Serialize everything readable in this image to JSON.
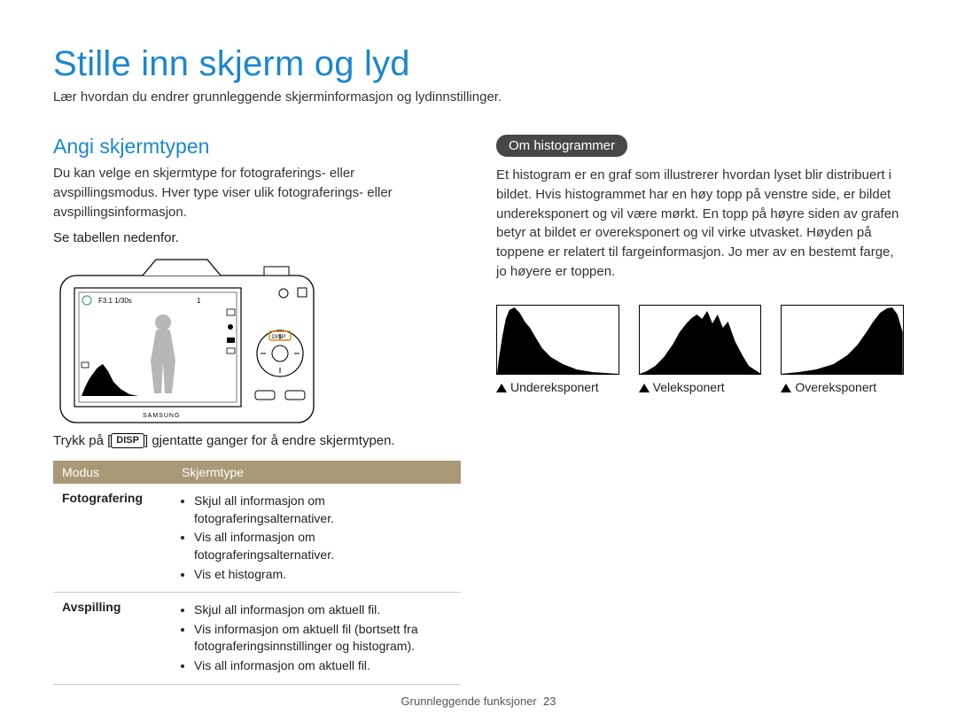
{
  "header": {
    "title": "Stille inn skjerm og lyd",
    "intro": "Lær hvordan du endrer grunnleggende skjerminformasjon og lydinnstillinger."
  },
  "left": {
    "heading": "Angi skjermtypen",
    "body": "Du kan velge en skjermtype for fotograferings- eller avspillingsmodus. Hver type viser ulik fotograferings- eller avspillingsinformasjon.",
    "see": "Se tabellen nedenfor.",
    "press_pre": "Trykk på [",
    "press_btn": "DISP",
    "press_post": "] gjentatte ganger for å endre skjermtypen.",
    "screen_readout": "F3.1 1/30s",
    "screen_count": "1",
    "disp_label": "DISP",
    "brand": "SAMSUNG",
    "table": {
      "col1": "Modus",
      "col2": "Skjermtype",
      "rows": [
        {
          "mode": "Fotografering",
          "items": [
            "Skjul all informasjon om fotograferingsalternativer.",
            "Vis all informasjon om fotograferingsalternativer.",
            "Vis et histogram."
          ]
        },
        {
          "mode": "Avspilling",
          "items": [
            "Skjul all informasjon om aktuell fil.",
            "Vis informasjon om aktuell fil (bortsett fra fotograferingsinnstillinger og histogram).",
            "Vis all informasjon om aktuell fil."
          ]
        }
      ]
    }
  },
  "right": {
    "badge": "Om histogrammer",
    "body": "Et histogram er en graf som illustrerer hvordan lyset blir distribuert i bildet. Hvis histogrammet har en høy topp på venstre side, er bildet undereksponert og vil være mørkt. En topp på høyre siden av grafen betyr at bildet er overeksponert og vil virke utvasket. Høyden på toppene er relatert til fargeinformasjon. Jo mer av en bestemt farge, jo høyere er toppen.",
    "histos": [
      {
        "label": "Undereksponert"
      },
      {
        "label": "Veleksponert"
      },
      {
        "label": "Overeksponert"
      }
    ]
  },
  "footer": {
    "section": "Grunnleggende funksjoner",
    "page": "23"
  }
}
